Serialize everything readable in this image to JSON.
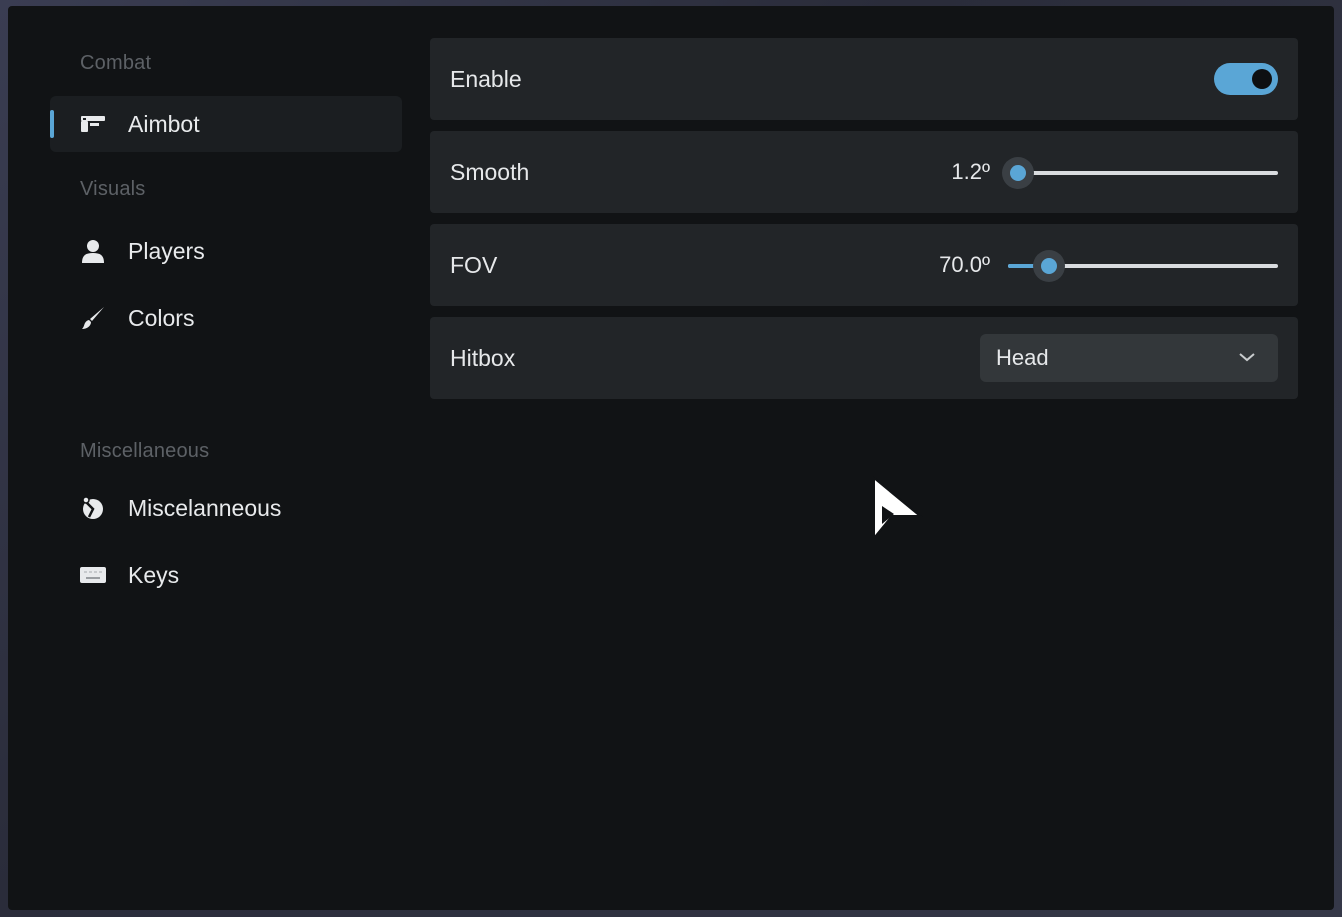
{
  "sidebar": {
    "sections": [
      {
        "label": "Combat"
      },
      {
        "label": "Visuals"
      },
      {
        "label": "Miscellaneous"
      }
    ],
    "items": [
      {
        "label": "Aimbot",
        "icon": "gun-icon",
        "active": true
      },
      {
        "label": "Players",
        "icon": "person-icon",
        "active": false
      },
      {
        "label": "Colors",
        "icon": "brush-icon",
        "active": false
      },
      {
        "label": "Miscelanneous",
        "icon": "misc-icon",
        "active": false
      },
      {
        "label": "Keys",
        "icon": "keyboard-icon",
        "active": false
      }
    ]
  },
  "settings": {
    "enable": {
      "label": "Enable",
      "value": true
    },
    "smooth": {
      "label": "Smooth",
      "value_text": "1.2º",
      "fraction": 0.0
    },
    "fov": {
      "label": "FOV",
      "value_text": "70.0º",
      "fraction": 0.15
    },
    "hitbox": {
      "label": "Hitbox",
      "selected": "Head"
    }
  },
  "colors": {
    "accent": "#5aa6d6",
    "background": "#111315",
    "row": "#222528"
  }
}
